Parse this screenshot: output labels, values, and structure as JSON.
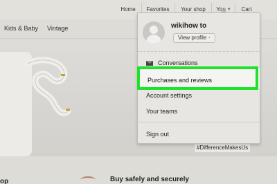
{
  "header": {
    "nav": [
      {
        "label": "Home",
        "icon": "home-icon"
      },
      {
        "label": "Favorites",
        "icon": "heart-icon"
      },
      {
        "label": "Your shop",
        "icon": "shop-icon"
      },
      {
        "label": "You",
        "icon": "user-icon"
      },
      {
        "label": "Cart",
        "icon": "cart-icon"
      }
    ]
  },
  "categories": [
    "Kids & Baby",
    "Vintage"
  ],
  "hero": {
    "hashtag": "#DifferenceMakesUs"
  },
  "bottom": {
    "left_text": "op",
    "heading": "Buy safely and securely"
  },
  "dropdown": {
    "username": "wikihow to",
    "view_profile": "View profile",
    "view_profile_icon": "chevron-right-icon",
    "items": [
      {
        "label": "Conversations",
        "icon": "mail-icon"
      },
      {
        "label": "Purchases and reviews"
      },
      {
        "label": "Account settings"
      },
      {
        "label": "Your teams"
      },
      {
        "label": "Sign out"
      }
    ]
  },
  "colors": {
    "highlight_border": "#1ee32a",
    "menu_bg": "#e7e6e2"
  }
}
